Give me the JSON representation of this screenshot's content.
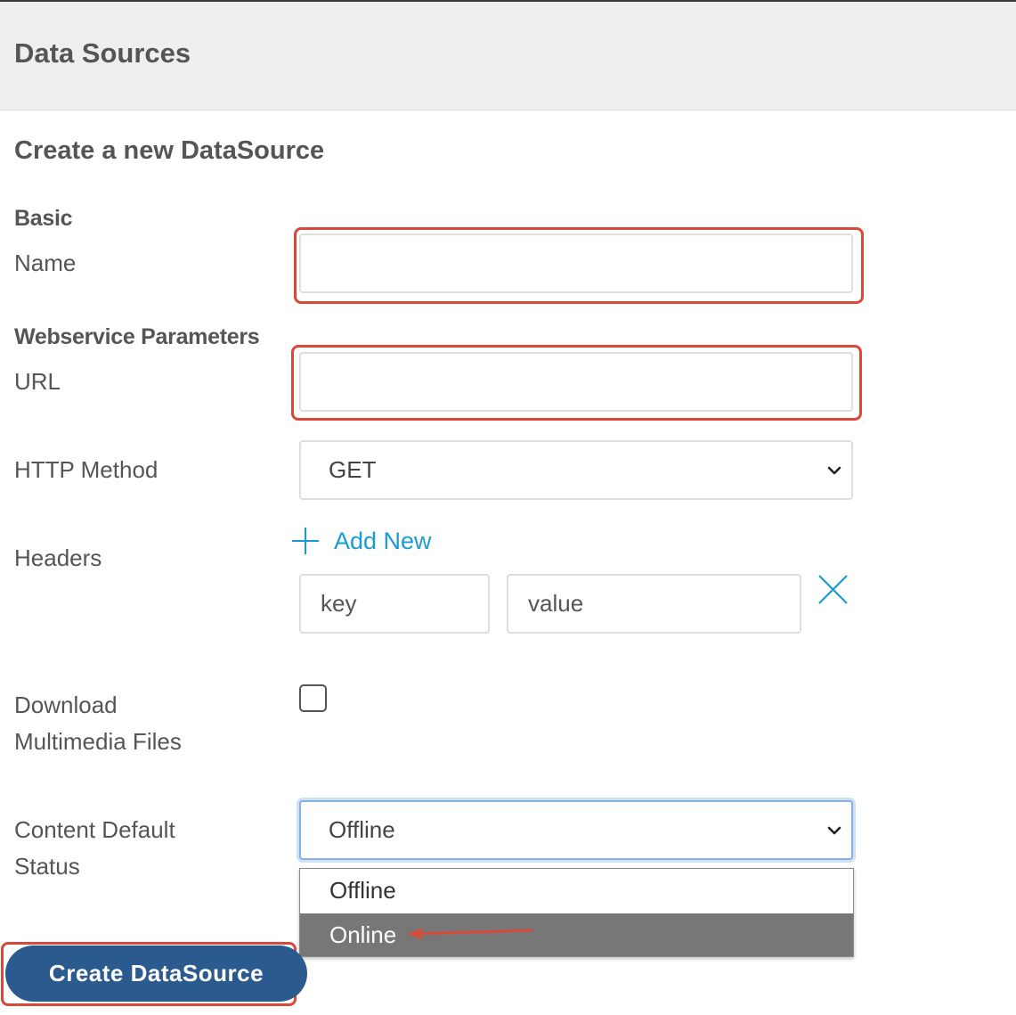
{
  "header": {
    "title": "Data Sources"
  },
  "form": {
    "title": "Create a new DataSource",
    "sections": {
      "basic": "Basic",
      "webservice": "Webservice Parameters"
    },
    "name": {
      "label": "Name",
      "value": ""
    },
    "url": {
      "label": "URL",
      "value": ""
    },
    "http_method": {
      "label": "HTTP Method",
      "selected": "GET"
    },
    "headers": {
      "label": "Headers",
      "add_new": "Add New",
      "key_placeholder": "key",
      "value_placeholder": "value"
    },
    "download_multimedia": {
      "label_line1": "Download",
      "label_line2": "Multimedia Files",
      "checked": false
    },
    "content_status": {
      "label_line1": "Content Default",
      "label_line2": "Status",
      "selected": "Offline",
      "options": [
        "Offline",
        "Online"
      ],
      "highlighted_option": "Online"
    },
    "submit_label": "Create DataSource"
  },
  "colors": {
    "accent_link": "#1a9bd1",
    "button": "#2b5a8e",
    "annotation": "#d9493a",
    "option_highlight": "#777777"
  }
}
